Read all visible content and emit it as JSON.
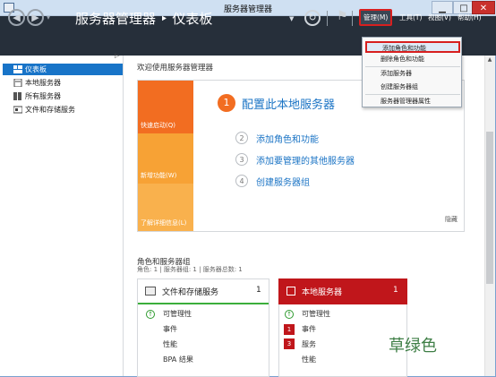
{
  "window": {
    "title": "服务器管理器",
    "controls": {
      "minimize": "▁",
      "maximize": "□",
      "close": "✕"
    }
  },
  "header": {
    "title": "服务器管理器 ‣ 仪表板",
    "back_icon": "◀",
    "forward_icon": "▶",
    "nav_dropdown_icon": "▾",
    "refresh_icon": "↻",
    "flag_icon": "⚑",
    "caret": "▼",
    "menus": {
      "manage": "管理(M)",
      "tools": "工具(T)",
      "view": "视图(V)",
      "help": "帮助(H)"
    }
  },
  "manage_menu": {
    "items": [
      "添加角色和功能",
      "删除角色和功能",
      "添加服务器",
      "创建服务器组",
      "服务器管理器属性"
    ]
  },
  "sidebar": {
    "items": [
      {
        "label": "仪表板",
        "selected": true
      },
      {
        "label": "本地服务器"
      },
      {
        "label": "所有服务器"
      },
      {
        "label": "文件和存储服务"
      }
    ],
    "expand_arrow": "▷"
  },
  "main": {
    "welcome": "欢迎使用服务器管理器",
    "quick_start": {
      "tiles": [
        "快速启动(Q)",
        "新增功能(W)",
        "了解详细信息(L)"
      ],
      "primary": {
        "number": "1",
        "label": "配置此本地服务器"
      },
      "steps": [
        {
          "number": "2",
          "label": "添加角色和功能"
        },
        {
          "number": "3",
          "label": "添加要管理的其他服务器"
        },
        {
          "number": "4",
          "label": "创建服务器组"
        }
      ],
      "hide": "隐藏"
    },
    "roles": {
      "title": "角色和服务器组",
      "subtitle": "角色: 1 | 服务器组: 1 | 服务器总数: 1",
      "cards": [
        {
          "title": "文件和存储服务",
          "count": "1",
          "rows": [
            {
              "label": "可管理性",
              "icon": "↑"
            },
            {
              "label": "事件"
            },
            {
              "label": "性能"
            },
            {
              "label": "BPA 结果"
            }
          ]
        },
        {
          "title": "本地服务器",
          "count": "1",
          "rows": [
            {
              "label": "可管理性",
              "icon": "↑"
            },
            {
              "label": "事件",
              "badge": "1"
            },
            {
              "label": "服务",
              "badge": "3"
            },
            {
              "label": "性能"
            }
          ]
        }
      ]
    },
    "watermark": "草绿色"
  },
  "scrollbar": {
    "up_icon": "▲"
  }
}
